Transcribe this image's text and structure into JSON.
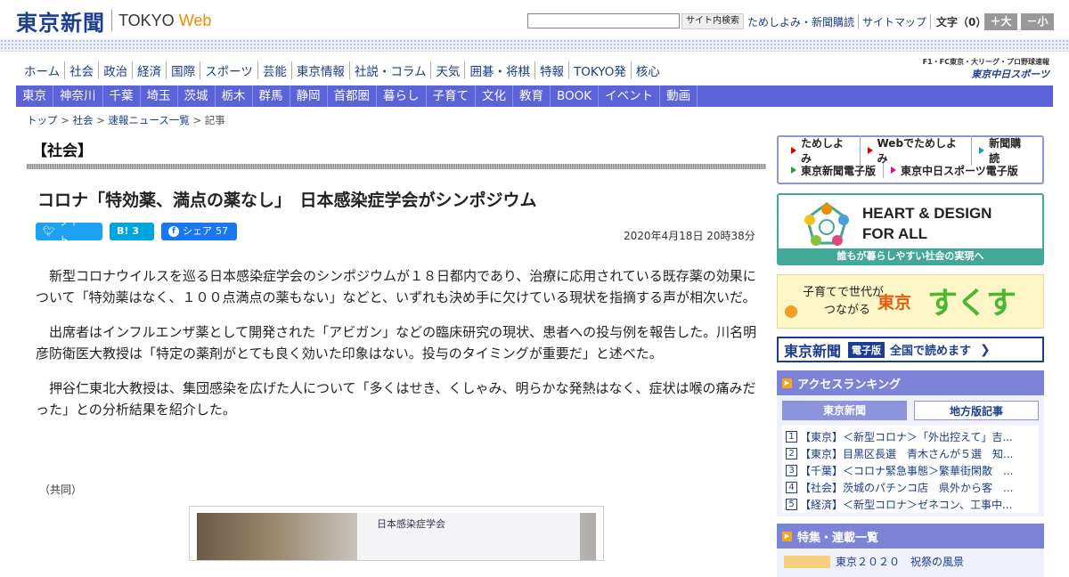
{
  "header": {
    "logo_kanji": "東京新聞",
    "logo_tokyo": "TOKYO",
    "logo_web": "Web",
    "search_button": "サイト内検索",
    "links": [
      "ためしよみ・新聞購読",
      "サイトマップ"
    ],
    "fontsize_label": "文字（0）",
    "fontsize_big": "＋大",
    "fontsize_small": "－小"
  },
  "nav_main": [
    "ホーム",
    "社会",
    "政治",
    "経済",
    "国際",
    "スポーツ",
    "芸能",
    "東京情報",
    "社説・コラム",
    "天気",
    "囲碁・将棋",
    "特報",
    "TOKYO発",
    "核心"
  ],
  "chunichi": {
    "top": "F1・FC東京・大リーグ・プロ野球速報",
    "logo": "東京中日スポーツ"
  },
  "nav_sub": [
    "東京",
    "神奈川",
    "千葉",
    "埼玉",
    "茨城",
    "栃木",
    "群馬",
    "静岡",
    "首都圏",
    "暮らし",
    "子育て",
    "文化",
    "教育",
    "BOOK",
    "イベント",
    "動画"
  ],
  "breadcrumb": {
    "items": [
      "トップ",
      "社会",
      "速報ニュース一覧"
    ],
    "current": "記事",
    "sep": " > "
  },
  "article": {
    "section": "【社会】",
    "headline": "コロナ「特効薬、満点の薬なし」　日本感染症学会がシンポジウム",
    "share": {
      "tweet": "ツイート",
      "hatena_icon": "B!",
      "hatena_count": "3",
      "fb_label": "シェア",
      "fb_count": "57"
    },
    "date": "2020年4月18日 20時38分",
    "paragraphs": [
      "新型コロナウイルスを巡る日本感染症学会のシンポジウムが１８日都内であり、治療に応用されている既存薬の効果について「特効薬はなく、１００点満点の薬もない」などと、いずれも決め手に欠けている現状を指摘する声が相次いだ。",
      "出席者はインフルエンザ薬として開発された「アビガン」などの臨床研究の現状、患者への投与例を報告した。川名明彦防衛医大教授は「特定の薬剤がとても良く効いた印象はない。投与のタイミングが重要だ」と述べた。",
      "押谷仁東北大教授は、集団感染を広げた人について「多くはせき、くしゃみ、明らかな発熱はなく、症状は喉の痛みだった」との分析結果を紹介した。"
    ],
    "credit": "（共同）",
    "photo_text": "日本感染症学会"
  },
  "sidebar": {
    "links_row1": [
      "ためしよみ",
      "Webでためしよみ",
      "新聞購読"
    ],
    "links_row2": [
      "東京新聞電子版",
      "東京中日スポーツ電子版"
    ],
    "heart_title_1": "HEART & DESIGN",
    "heart_title_2": "FOR ALL",
    "heart_sub": "誰もが暮らしやすい社会の実現へ",
    "suku_a": "子育てで世代が",
    "suku_b": "つながる",
    "suku_tokyo": "東京",
    "suku_main": "すくすく",
    "edition_logo": "東京新聞",
    "edition_badge": "電子版",
    "edition_text": "全国で読めます",
    "ranking_title": "アクセスランキング",
    "ranking_tabs": [
      "東京新聞",
      "地方版記事"
    ],
    "ranking": [
      {
        "num": "1",
        "text": "【東京】＜新型コロナ＞「外出控えて」吉..."
      },
      {
        "num": "2",
        "text": "【東京】目黒区長選　青木さんが５選　知..."
      },
      {
        "num": "3",
        "text": "【千葉】＜コロナ緊急事態＞繁華街閑散　..."
      },
      {
        "num": "4",
        "text": "【社会】茨城のパチンコ店　県外から客　..."
      },
      {
        "num": "5",
        "text": "【経済】＜新型コロナ＞ゼネコン、工事中..."
      }
    ],
    "features_title": "特集・連載一覧",
    "features_item": "東京２０２０　祝祭の風景"
  }
}
